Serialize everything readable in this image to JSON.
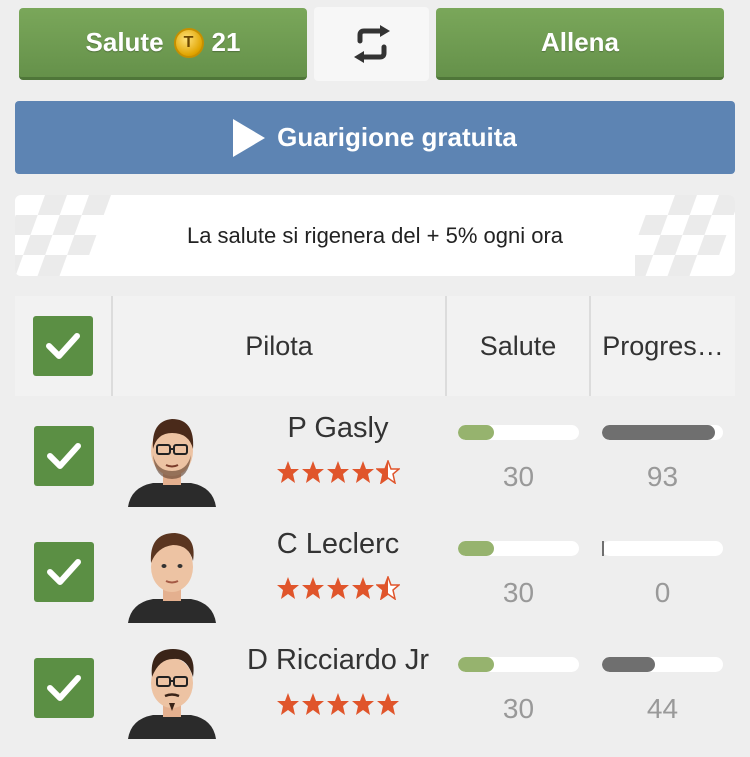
{
  "top_buttons": {
    "salute_label": "Salute",
    "salute_cost": "21",
    "coin_symbol": "T",
    "allena_label": "Allena"
  },
  "free_heal_label": "Guarigione gratuita",
  "info_text": "La salute si rigenera del + 5% ogni ora",
  "table": {
    "headers": {
      "pilota": "Pilota",
      "salute": "Salute",
      "progress": "Progres…"
    },
    "rows": [
      {
        "name": "P Gasly",
        "stars": 4.5,
        "health": "30",
        "health_fraction": 0.3,
        "progress": "93",
        "progress_fraction": 0.93,
        "checked": true,
        "avatar": "driver-avatar-glasses-beard"
      },
      {
        "name": "C Leclerc",
        "stars": 4.5,
        "health": "30",
        "health_fraction": 0.3,
        "progress": "0",
        "progress_fraction": 0.0,
        "checked": true,
        "avatar": "driver-avatar"
      },
      {
        "name": "D Ricciardo Jr",
        "stars": 5,
        "health": "30",
        "health_fraction": 0.3,
        "progress": "44",
        "progress_fraction": 0.44,
        "checked": true,
        "avatar": "driver-avatar-glasses-goatee"
      }
    ]
  },
  "colors": {
    "green_button": "#6e9b51",
    "blue_button": "#5d84b3",
    "star": "#e0552b",
    "health_fill": "#96b36e",
    "progress_fill": "#6f6f6f"
  }
}
